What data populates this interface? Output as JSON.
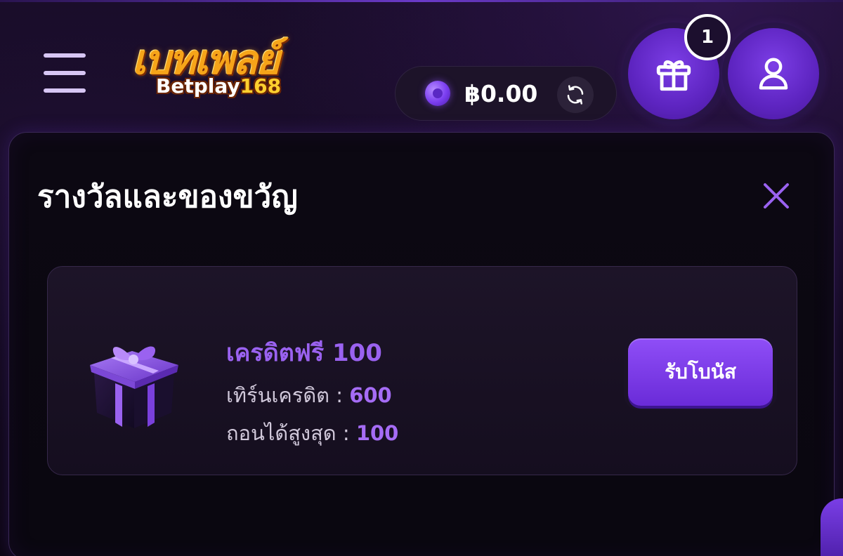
{
  "header": {
    "logo": {
      "thai_text": "เบทเพลย์",
      "en_text": "Betplay",
      "en_number": "168"
    },
    "balance": {
      "amount": "฿0.00"
    },
    "notifications": {
      "count": "1"
    },
    "icons": {
      "menu": "hamburger-menu-icon",
      "coin": "coin-icon",
      "refresh": "refresh-icon",
      "gift": "gift-icon",
      "user": "user-icon"
    }
  },
  "panel": {
    "title": "รางวัลและของขวัญ",
    "close_icon": "close-icon",
    "reward": {
      "title": "เครดิตฟรี 100",
      "turnover_label": "เทิร์นเครดิต :",
      "turnover_value": "600",
      "withdraw_label": "ถอนได้สูงสุด :",
      "withdraw_value": "100",
      "claim_label": "รับโบนัส"
    }
  },
  "colors": {
    "accent": "#7c3ee6",
    "accent_text": "#9a62f0",
    "background": "#0d0714",
    "logo_gold": "#f6a419"
  }
}
